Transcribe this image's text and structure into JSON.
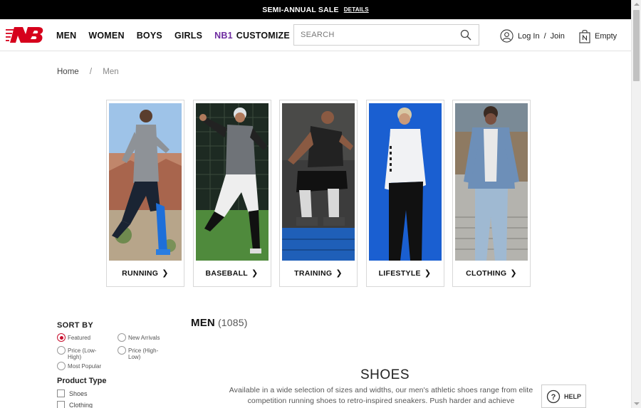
{
  "promo": {
    "text": "SEMI-ANNUAL SALE",
    "link": "DETAILS"
  },
  "nav": {
    "men": "MEN",
    "women": "WOMEN",
    "boys": "BOYS",
    "girls": "GIRLS",
    "nb1": "NB1",
    "customize": "CUSTOMIZE"
  },
  "search": {
    "placeholder": "SEARCH"
  },
  "account": {
    "login": "Log In",
    "sep": "/",
    "join": "Join"
  },
  "cart": {
    "label": "Empty"
  },
  "breadcrumb": {
    "home": "Home",
    "sep": "/",
    "current": "Men"
  },
  "categories": [
    {
      "label": "RUNNING"
    },
    {
      "label": "BASEBALL"
    },
    {
      "label": "TRAINING"
    },
    {
      "label": "LIFESTYLE"
    },
    {
      "label": "CLOTHING"
    }
  ],
  "sort": {
    "title": "SORT BY",
    "options": [
      {
        "label": "Featured",
        "selected": true
      },
      {
        "label": "New Arrivals",
        "selected": false
      },
      {
        "label": "Price (Low-High)",
        "selected": false
      },
      {
        "label": "Price (High-Low)",
        "selected": false
      },
      {
        "label": "Most Popular",
        "selected": false
      }
    ]
  },
  "product_type": {
    "title": "Product Type",
    "options": [
      "Shoes",
      "Clothing"
    ]
  },
  "results": {
    "title": "MEN",
    "count": "(1085)"
  },
  "section": {
    "title": "SHOES",
    "description_1": "Available in a wide selection of sizes and widths, our men's athletic shoes range from elite",
    "description_2": "competition running shoes to retro-inspired sneakers. Push harder and achieve"
  },
  "help": {
    "label": "HELP"
  },
  "colors": {
    "brand_red": "#c8102e",
    "nb1_purple": "#6e2ca0",
    "promo_bg": "#000000"
  }
}
